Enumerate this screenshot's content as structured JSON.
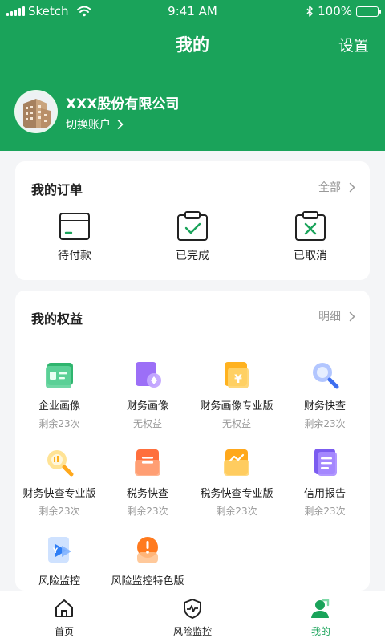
{
  "status_bar": {
    "carrier": "Sketch",
    "time": "9:41 AM",
    "battery": "100%"
  },
  "header": {
    "title": "我的",
    "settings_label": "设置"
  },
  "account": {
    "company_name": "XXX股份有限公司",
    "switch_label": "切换账户"
  },
  "orders": {
    "title": "我的订单",
    "more_label": "全部",
    "items": [
      {
        "label": "待付款",
        "icon": "wallet-card-icon"
      },
      {
        "label": "已完成",
        "icon": "clipboard-check-icon"
      },
      {
        "label": "已取消",
        "icon": "clipboard-x-icon"
      }
    ]
  },
  "rights": {
    "title": "我的权益",
    "more_label": "明细",
    "items": [
      {
        "name": "企业画像",
        "sub": "剩余23次",
        "icon": "id-card-icon",
        "color": "#3ec17a"
      },
      {
        "name": "财务画像",
        "sub": "无权益",
        "icon": "finance-profile-icon",
        "color": "#8a5cf5"
      },
      {
        "name": "财务画像专业版",
        "sub": "无权益",
        "icon": "yuan-icon",
        "color": "#ffb01f"
      },
      {
        "name": "财务快查",
        "sub": "剩余23次",
        "icon": "magnifier-icon",
        "color": "#4b7df0"
      },
      {
        "name": "财务快查专业版",
        "sub": "剩余23次",
        "icon": "magnifier-pro-icon",
        "color": "#ffb01f"
      },
      {
        "name": "税务快查",
        "sub": "剩余23次",
        "icon": "tax-doc-icon",
        "color": "#ff7a3d"
      },
      {
        "name": "税务快查专业版",
        "sub": "剩余23次",
        "icon": "tax-chart-icon",
        "color": "#ffa81c"
      },
      {
        "name": "信用报告",
        "sub": "剩余23次",
        "icon": "report-icon",
        "color": "#7b5cf0"
      },
      {
        "name": "风险监控",
        "sub": "",
        "icon": "risk-monitor-icon",
        "color": "#2f7ef5"
      },
      {
        "name": "风险监控特色版",
        "sub": "",
        "icon": "warning-icon",
        "color": "#ff8a1e"
      }
    ]
  },
  "tabbar": {
    "items": [
      {
        "label": "首页",
        "icon": "home-icon"
      },
      {
        "label": "风险监控",
        "icon": "shield-pulse-icon"
      },
      {
        "label": "我的",
        "icon": "user-icon",
        "active": true
      }
    ]
  },
  "colors": {
    "brand": "#1aa35a",
    "background": "#f4f5f7",
    "muted": "#999999"
  }
}
